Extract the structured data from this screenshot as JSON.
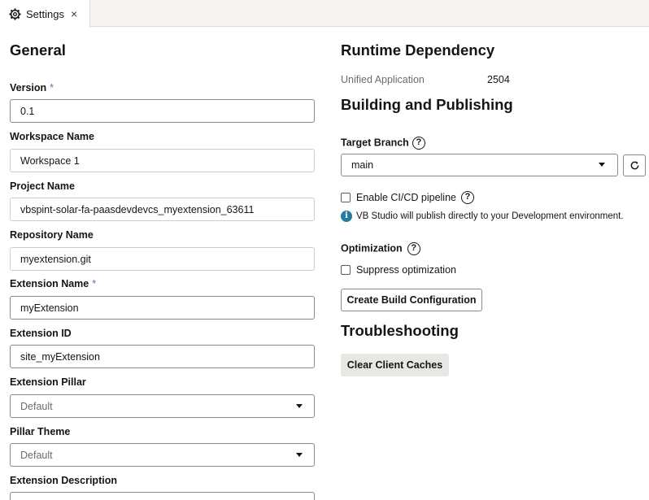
{
  "tab": {
    "label": "Settings",
    "close_glyph": "×",
    "icon": "gear-icon"
  },
  "general": {
    "title": "General",
    "fields": {
      "version": {
        "label": "Version",
        "required_mark": "*",
        "value": "0.1"
      },
      "workspace_name": {
        "label": "Workspace Name",
        "value": "Workspace 1"
      },
      "project_name": {
        "label": "Project Name",
        "value": "vbspint-solar-fa-paasdevdevcs_myextension_63611"
      },
      "repository_name": {
        "label": "Repository Name",
        "value": "myextension.git"
      },
      "extension_name": {
        "label": "Extension Name",
        "required_mark": "*",
        "value": "myExtension"
      },
      "extension_id": {
        "label": "Extension ID",
        "value": "site_myExtension"
      },
      "extension_pillar": {
        "label": "Extension Pillar",
        "placeholder": "Default"
      },
      "pillar_theme": {
        "label": "Pillar Theme",
        "placeholder": "Default"
      },
      "extension_description": {
        "label": "Extension Description"
      }
    }
  },
  "runtime": {
    "title": "Runtime Dependency",
    "unified_label": "Unified Application",
    "unified_value": "2504"
  },
  "building": {
    "title": "Building and Publishing",
    "target_branch_label": "Target Branch",
    "target_branch_value": "main",
    "cicd_label": "Enable CI/CD pipeline",
    "info_glyph": "i",
    "info_text": "VB Studio will publish directly to your Development environment.",
    "optimization_label": "Optimization",
    "suppress_label": "Suppress optimization",
    "create_build_button": "Create Build Configuration",
    "help_glyph": "?"
  },
  "troubleshooting": {
    "title": "Troubleshooting",
    "clear_caches_button": "Clear Client Caches"
  },
  "colors": {
    "required": "#4e74b8",
    "info": "#227e9e",
    "button_bg": "#e9e7e4"
  }
}
